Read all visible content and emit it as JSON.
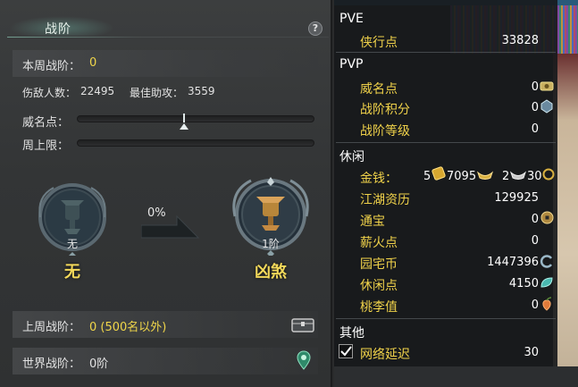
{
  "left_panel": {
    "title": "战阶",
    "help_label": "?",
    "weekly_rank_label": "本周战阶：",
    "weekly_rank_value": "0",
    "wounded_label": "伤敌人数：",
    "wounded_value": "22495",
    "best_assist_label": "最佳助攻：",
    "best_assist_value": "3559",
    "prestige_label": "威名点：",
    "weekly_cap_label": "周上限：",
    "current_rank": {
      "level": "无",
      "name": "无"
    },
    "progress_percent": "0%",
    "next_rank": {
      "level": "1阶",
      "name": "凶煞"
    },
    "last_week_label": "上周战阶：",
    "last_week_value": "0 (500名以外)",
    "world_rank_label": "世界战阶：",
    "world_rank_value": "0阶",
    "icons": {
      "help": "question-icon",
      "chest": "chest-icon",
      "location": "map-pin-icon"
    }
  },
  "right_panel": {
    "pve": {
      "title": "PVE",
      "items": [
        {
          "label": "侠行点",
          "value": "33828"
        }
      ]
    },
    "pvp": {
      "title": "PVP",
      "items": [
        {
          "label": "威名点",
          "value": "0"
        },
        {
          "label": "战阶积分",
          "value": "0"
        },
        {
          "label": "战阶等级",
          "value": "0"
        }
      ]
    },
    "leisure": {
      "title": "休闲",
      "money_label": "金钱：",
      "money_gold": "5",
      "money_silver": "7095",
      "money_copper_a": "2",
      "money_copper_b": "30",
      "items": [
        {
          "label": "江湖资历",
          "value": "129925"
        },
        {
          "label": "通宝",
          "value": "0"
        },
        {
          "label": "薪火点",
          "value": "0"
        },
        {
          "label": "园宅币",
          "value": "1447396"
        },
        {
          "label": "休闲点",
          "value": "4150"
        },
        {
          "label": "桃李值",
          "value": "0"
        }
      ]
    },
    "other": {
      "title": "其他",
      "latency_label": "网络延迟",
      "latency_value": "30",
      "latency_checked": true
    }
  },
  "colors": {
    "accent_yellow": "#f0d24a",
    "panel_bg": "#333536",
    "text_white": "#ffffff"
  }
}
